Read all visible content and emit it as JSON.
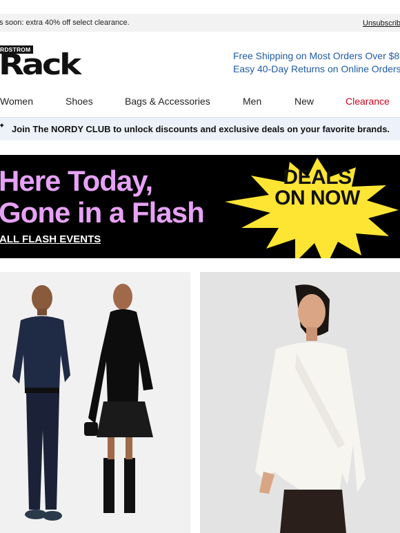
{
  "preheader": {
    "text": "s soon: extra 40% off select clearance.",
    "unsubscribe": "Unsubscrib"
  },
  "logo": {
    "top_text": "RDSTROM",
    "main_text": "Rack"
  },
  "promos": {
    "shipping": "Free Shipping on Most Orders Over $8",
    "returns": "Easy 40-Day Returns on Online Orders"
  },
  "nav": {
    "items": [
      "Women",
      "Shoes",
      "Bags & Accessories",
      "Men",
      "New",
      "Clearance"
    ]
  },
  "club": {
    "text": "Join The NORDY CLUB to unlock discounts and exclusive deals on your favorite brands."
  },
  "hero": {
    "headline_line1": "Here Today,",
    "headline_line2": "Gone in a Flash",
    "cta": "ALL FLASH EVENTS",
    "burst_line1": "DEALS",
    "burst_line2": "ON NOW",
    "colors": {
      "background": "#000000",
      "headline": "#e6a2f5",
      "burst": "#ffe533"
    }
  },
  "tiles": [
    {
      "name": "couple-outfits-photo"
    },
    {
      "name": "white-wrap-shirt-photo"
    }
  ],
  "colors": {
    "link": "#1f5aa8",
    "clearance": "#d0021b",
    "club_bar": "#edf2fa"
  }
}
